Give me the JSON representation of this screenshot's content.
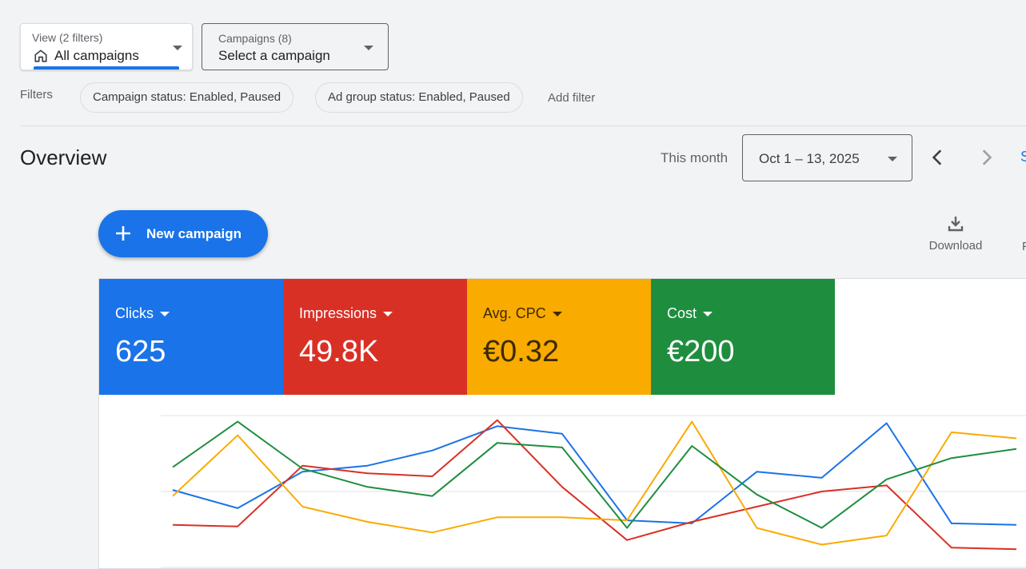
{
  "view_select": {
    "small_label": "View (2 filters)",
    "value": "All campaigns"
  },
  "campaign_select": {
    "small_label": "Campaigns (8)",
    "value": "Select a campaign"
  },
  "filters": {
    "label": "Filters",
    "chips": [
      "Campaign status: Enabled, Paused",
      "Ad group status: Enabled, Paused"
    ],
    "add_label": "Add filter"
  },
  "overview": {
    "title": "Overview",
    "date_range_label": "This month",
    "date_range_value": "Oct 1 – 13, 2025",
    "edge_link": "S"
  },
  "actions": {
    "new_campaign": "New campaign",
    "download": "Download",
    "edge_truncated": "F"
  },
  "colors": {
    "blue": "#1a73e8",
    "red": "#d93025",
    "yellow": "#f9ab00",
    "green": "#1e8e3e"
  },
  "metrics": [
    {
      "name": "Clicks",
      "value": "625",
      "color": "#1a73e8",
      "text_color": "#ffffff"
    },
    {
      "name": "Impressions",
      "value": "49.8K",
      "color": "#d93025",
      "text_color": "#ffffff"
    },
    {
      "name": "Avg. CPC",
      "value": "€0.32",
      "color": "#f9ab00",
      "text_color": "#3c2a00"
    },
    {
      "name": "Cost",
      "value": "€200",
      "color": "#1e8e3e",
      "text_color": "#ffffff"
    }
  ],
  "chart_data": {
    "type": "line",
    "title": "",
    "xlabel": "",
    "ylabel": "",
    "ylim": [
      0,
      100
    ],
    "grid": true,
    "x": [
      1,
      2,
      3,
      4,
      5,
      6,
      7,
      8,
      9,
      10,
      11,
      12,
      13,
      14
    ],
    "series": [
      {
        "name": "Clicks",
        "color": "#1a73e8",
        "values": [
          51,
          39,
          63,
          67,
          77,
          93,
          88,
          31,
          29,
          63,
          59,
          95,
          29,
          28
        ]
      },
      {
        "name": "Impressions",
        "color": "#d93025",
        "values": [
          28,
          27,
          67,
          62,
          60,
          97,
          53,
          18,
          30,
          40,
          50,
          54,
          13,
          12
        ]
      },
      {
        "name": "Avg. CPC",
        "color": "#f9ab00",
        "values": [
          47,
          87,
          40,
          30,
          23,
          33,
          33,
          31,
          96,
          26,
          15,
          21,
          89,
          85
        ]
      },
      {
        "name": "Cost",
        "color": "#1e8e3e",
        "values": [
          66,
          96,
          65,
          53,
          47,
          82,
          79,
          26,
          80,
          48,
          26,
          58,
          72,
          78
        ]
      }
    ]
  }
}
